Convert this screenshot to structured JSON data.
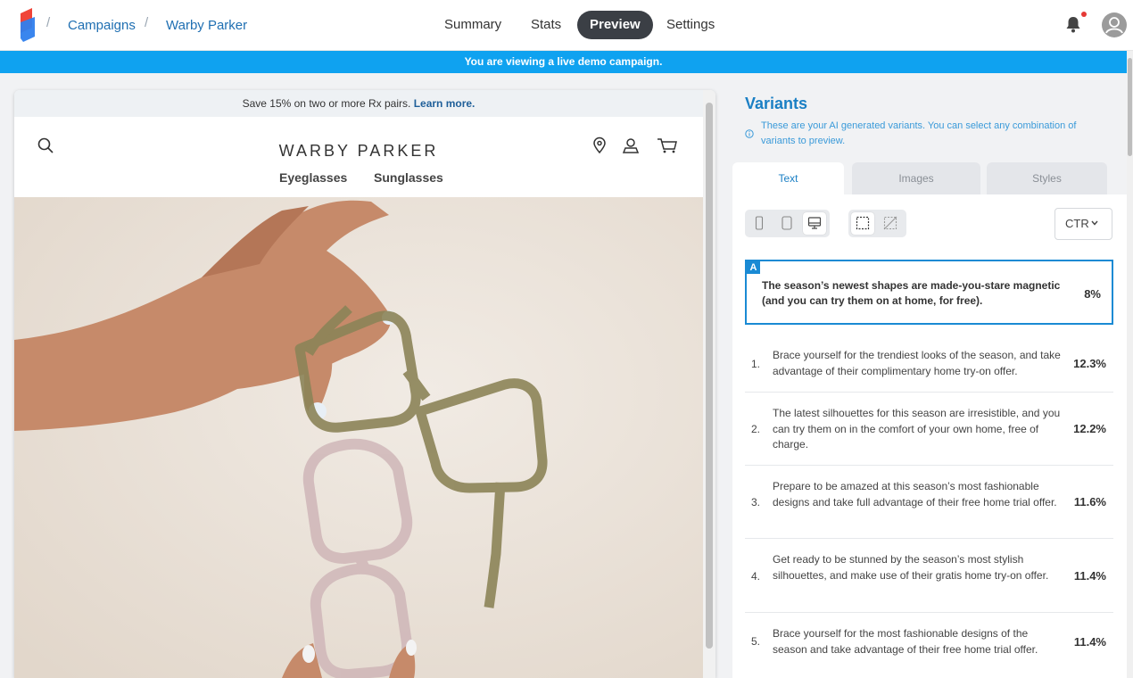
{
  "breadcrumb": [
    "Campaigns",
    "Warby Parker"
  ],
  "nav_tabs": [
    {
      "label": "Summary",
      "active": false
    },
    {
      "label": "Stats",
      "active": false
    },
    {
      "label": "Preview",
      "active": true
    },
    {
      "label": "Settings",
      "active": false
    }
  ],
  "demo_banner": "You are viewing a live demo campaign.",
  "preview": {
    "promo_text": "Save 15% on two or more Rx pairs.",
    "promo_link": "Learn more.",
    "brand": "WARBY PARKER",
    "nav_items": [
      "Eyeglasses",
      "Sunglasses"
    ]
  },
  "variants": {
    "title": "Variants",
    "description": "These are your AI generated variants. You can select any combination of variants to preview.",
    "tabs": [
      "Text",
      "Images",
      "Styles"
    ],
    "active_tab": "Text",
    "metric": "CTR",
    "original": {
      "tag": "A",
      "text": "The season’s newest shapes are made-you-stare magnetic (and you can try them on at home, for free).",
      "value": "8%"
    },
    "items": [
      {
        "num": "1.",
        "text": "Brace yourself for the trendiest looks of the season, and take advantage of their complimentary home try-on offer.",
        "value": "12.3%"
      },
      {
        "num": "2.",
        "text": "The latest silhouettes for this season are irresistible, and you can try them on in the comfort of your own home, free of charge.",
        "value": "12.2%"
      },
      {
        "num": "3.",
        "text": "Prepare to be amazed at this season’s most fashionable designs and take full advantage of their free home trial offer.",
        "value": "11.6%"
      },
      {
        "num": "4.",
        "text": "Get ready to be stunned by the season’s most stylish silhouettes, and make use of their gratis home try-on offer.",
        "value": "11.4%"
      },
      {
        "num": "5.",
        "text": "Brace yourself for the most fashionable designs of the season and take advantage of their free home trial offer.",
        "value": "11.4%"
      }
    ]
  },
  "colors": {
    "accent": "#1a7fc4",
    "banner": "#0fa2f0",
    "active_tab": "#3b3f45",
    "logo_red": "#f04438",
    "logo_blue": "#2f80ed"
  }
}
